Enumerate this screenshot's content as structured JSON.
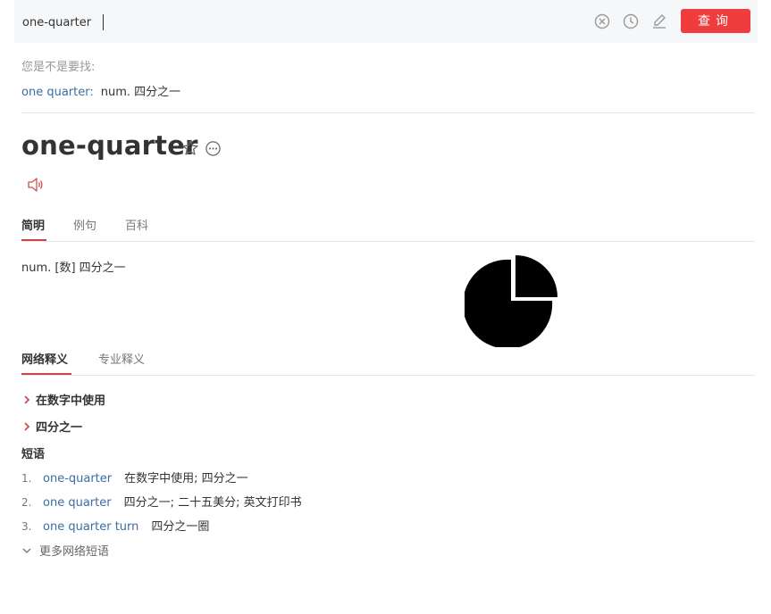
{
  "search": {
    "value": "one-quarter",
    "button_label": "查询"
  },
  "suggestion": {
    "title": "您是不是要找:",
    "word": "one quarter",
    "separator": ":",
    "definition": "num. 四分之一"
  },
  "entry": {
    "headword": "one-quarter"
  },
  "tabs_basic": [
    "简明",
    "例句",
    "百科"
  ],
  "basic_definition": "num. [数] 四分之一",
  "tabs_web": [
    "网络释义",
    "专业释义"
  ],
  "web_senses": [
    "在数字中使用",
    "四分之一"
  ],
  "phrases_title": "短语",
  "phrases": [
    {
      "num": "1.",
      "word": "one-quarter",
      "def": "在数字中使用; 四分之一"
    },
    {
      "num": "2.",
      "word": "one quarter",
      "def": "四分之一; 二十五美分; 英文打印书"
    },
    {
      "num": "3.",
      "word": "one quarter turn",
      "def": "四分之一圈"
    }
  ],
  "more_phrases": "更多网络短语",
  "colors": {
    "accent_red": "#ef3c3c",
    "tab_underline": "#c8454a",
    "link_blue": "#3a6ea5"
  },
  "icons": [
    "clear-icon",
    "history-icon",
    "edit-icon",
    "star-icon",
    "more-icon",
    "speaker-icon",
    "chevron-right-icon",
    "chevron-down-icon",
    "pie-chart-icon"
  ]
}
